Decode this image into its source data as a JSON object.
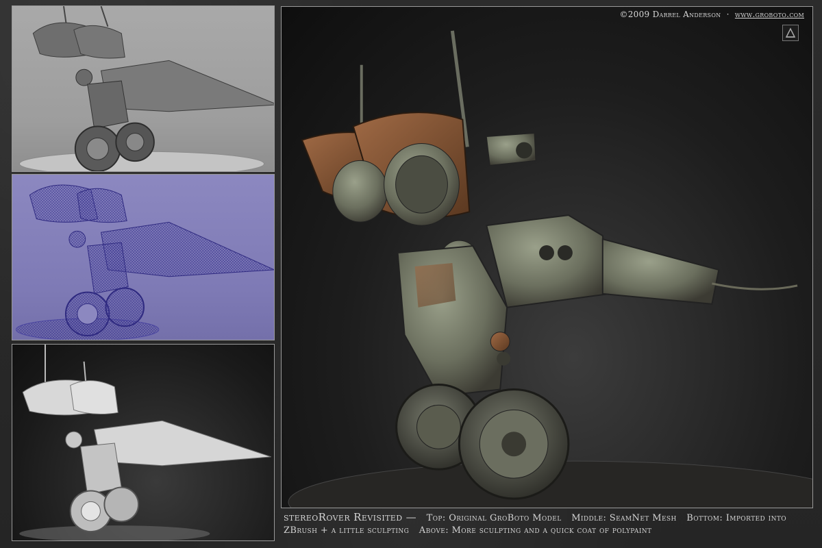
{
  "copyright": {
    "year_owner": "©2009 Darrel Anderson",
    "separator": "·",
    "url": "www.groboto.com"
  },
  "caption": {
    "title": "stereoRover Revisited —",
    "top": "Top: Original GroBoto Model",
    "middle": "Middle: SeamNet Mesh",
    "bottom": "Bottom: Imported into ZBrush + a little sculpting",
    "above": "Above: More sculpting and a quick coat of polypaint"
  },
  "colors": {
    "page_background": "#2a2a2a",
    "panel_top": "#a9a9a9",
    "panel_middle": "#8c88c0",
    "panel_bottom": "#1a1a1a",
    "main_background": "#1d1d1d",
    "rust_copper": "#8a5a3a",
    "verdigris": "#6b7a6a"
  },
  "images": {
    "top": "robot-render-groboto-gray",
    "middle": "robot-render-seamnet-wireframe-blue",
    "bottom": "robot-render-zbrush-white",
    "main": "robot-render-polypaint-copper"
  }
}
